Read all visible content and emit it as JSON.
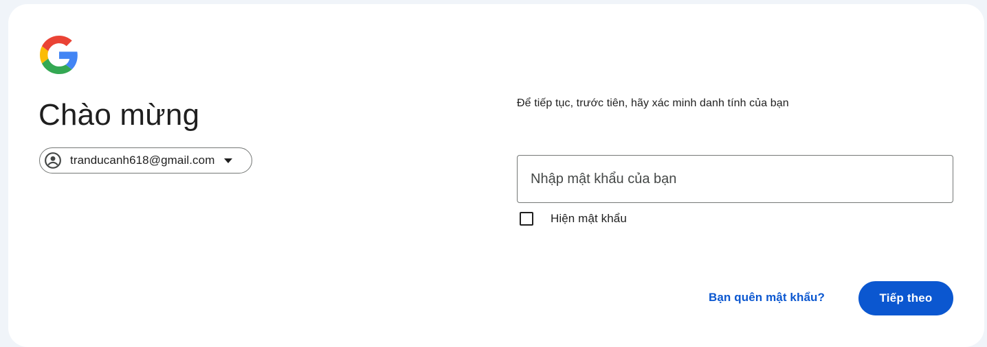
{
  "header": {
    "logo_icon": "google-g-logo-icon",
    "title": "Chào mừng"
  },
  "account": {
    "email": "tranducanh618@gmail.com",
    "avatar_icon": "account-circle-icon",
    "dropdown_icon": "caret-down-icon"
  },
  "form": {
    "subtitle": "Để tiếp tục, trước tiên, hãy xác minh danh tính của bạn",
    "password_placeholder": "Nhập mật khẩu của bạn",
    "password_value": "",
    "show_password_label": "Hiện mật khẩu",
    "show_password_checked": false
  },
  "actions": {
    "forgot_label": "Bạn quên mật khẩu?",
    "next_label": "Tiếp theo"
  },
  "colors": {
    "page_background": "#f0f4f9",
    "card_background": "#ffffff",
    "accent": "#0b57d0",
    "text": "#1f1f1f",
    "outline": "#747775"
  }
}
